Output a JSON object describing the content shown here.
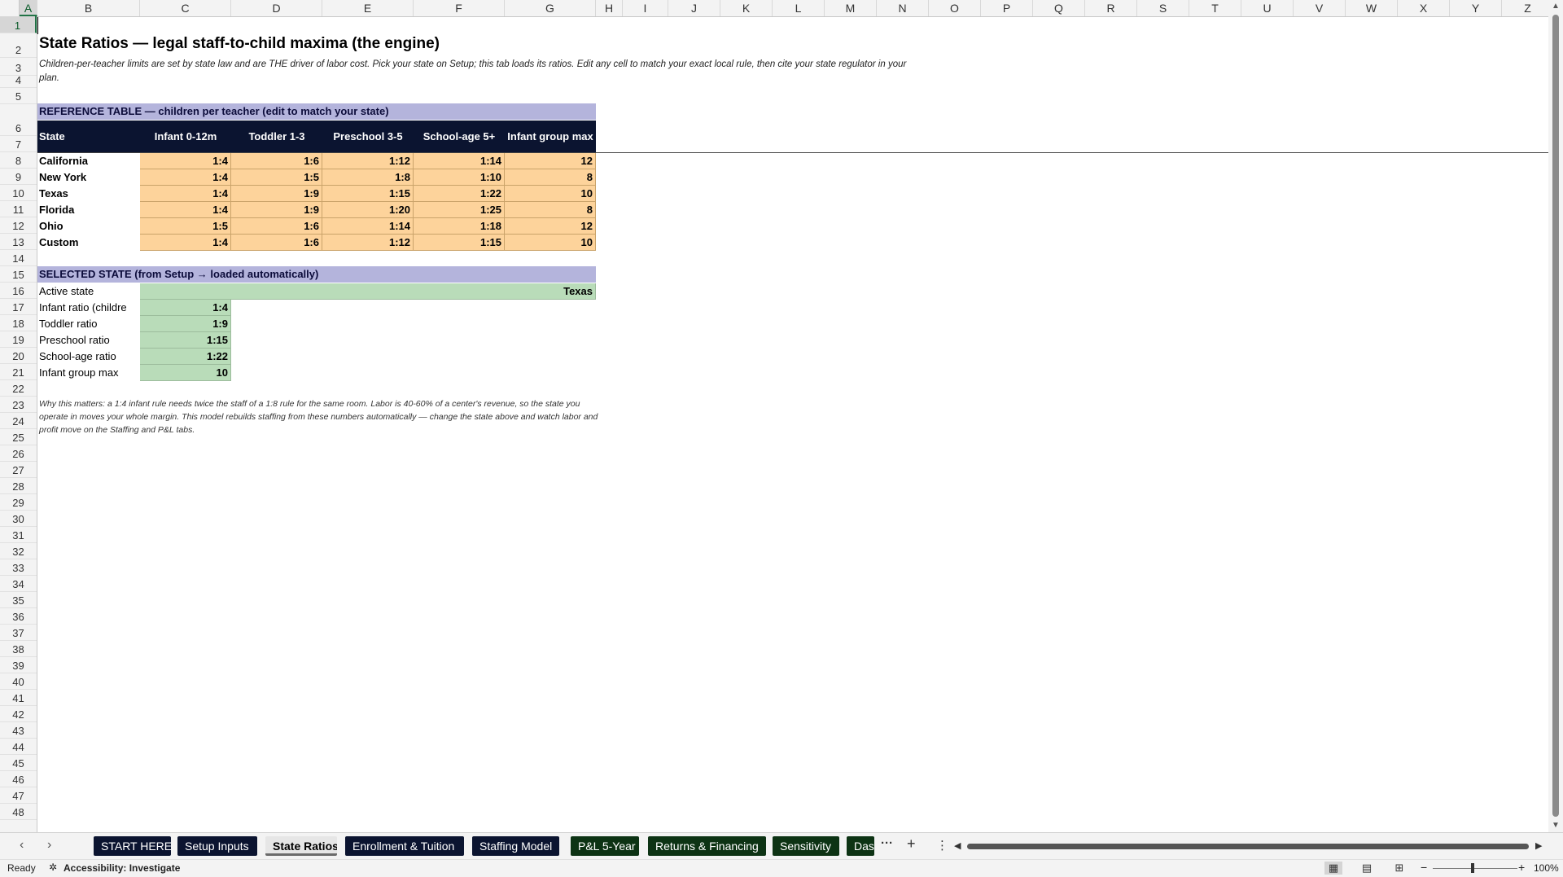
{
  "columns": [
    "A",
    "B",
    "C",
    "D",
    "E",
    "F",
    "G",
    "H",
    "I",
    "J",
    "K",
    "L",
    "M",
    "N",
    "O",
    "P",
    "Q",
    "R",
    "S",
    "T",
    "U",
    "V",
    "W",
    "X",
    "Y",
    "Z"
  ],
  "rows": [
    "1",
    "2",
    "3",
    "4",
    "5",
    "6",
    "7",
    "8",
    "9",
    "10",
    "11",
    "12",
    "13",
    "14",
    "15",
    "16",
    "17",
    "18",
    "19",
    "20",
    "21",
    "22",
    "23",
    "24",
    "25",
    "26",
    "27",
    "28",
    "29",
    "30",
    "31",
    "32",
    "33",
    "34",
    "35",
    "36",
    "37",
    "38",
    "39",
    "40",
    "41",
    "42",
    "43",
    "44",
    "45",
    "46",
    "47",
    "48"
  ],
  "sheet": {
    "title": "State Ratios — legal staff-to-child maxima (the engine)",
    "subtitle": "Children-per-teacher limits are set by state law and are THE driver of labor cost. Pick your state on Setup; this tab loads its ratios. Edit any cell to match your exact local rule, then cite your state regulator in your plan.",
    "reference_band": "REFERENCE TABLE — children per teacher (edit to match your state)",
    "table_headers": [
      "State",
      "Infant 0-12m",
      "Toddler 1-3",
      "Preschool 3-5",
      "School-age 5+",
      "Infant group max"
    ],
    "table_rows": [
      {
        "state": "California",
        "infant": "1:4",
        "toddler": "1:6",
        "preschool": "1:12",
        "school": "1:14",
        "group": "12"
      },
      {
        "state": "New York",
        "infant": "1:4",
        "toddler": "1:5",
        "preschool": "1:8",
        "school": "1:10",
        "group": "8"
      },
      {
        "state": "Texas",
        "infant": "1:4",
        "toddler": "1:9",
        "preschool": "1:15",
        "school": "1:22",
        "group": "10"
      },
      {
        "state": "Florida",
        "infant": "1:4",
        "toddler": "1:9",
        "preschool": "1:20",
        "school": "1:25",
        "group": "8"
      },
      {
        "state": "Ohio",
        "infant": "1:5",
        "toddler": "1:6",
        "preschool": "1:14",
        "school": "1:18",
        "group": "12"
      },
      {
        "state": "Custom",
        "infant": "1:4",
        "toddler": "1:6",
        "preschool": "1:12",
        "school": "1:15",
        "group": "10"
      }
    ],
    "selected_band": "SELECTED STATE  (from Setup → loaded automatically)",
    "active_state_label": "Active state",
    "active_state_value": "Texas",
    "selected_rows": [
      {
        "label": "Infant ratio (childre",
        "value": "1:4"
      },
      {
        "label": "Toddler ratio",
        "value": "1:9"
      },
      {
        "label": "Preschool ratio",
        "value": "1:15"
      },
      {
        "label": "School-age ratio",
        "value": "1:22"
      },
      {
        "label": "Infant group max",
        "value": "10"
      }
    ],
    "note": "Why this matters: a 1:4 infant rule needs twice the staff of a 1:8 rule for the same room. Labor is 40-60% of a center's revenue, so the state you operate in moves your whole margin. This model rebuilds staffing from these numbers automatically — change the state above and watch labor and profit move on the Staffing and P&L tabs."
  },
  "tabs": [
    {
      "label": "START HERE",
      "color": "#0b1430",
      "active": false
    },
    {
      "label": "Setup Inputs",
      "color": "#0b1430",
      "active": false
    },
    {
      "label": "State Ratios",
      "color": "#e6e6e6",
      "active": true
    },
    {
      "label": "Enrollment & Tuition",
      "color": "#0b1430",
      "active": false
    },
    {
      "label": "Staffing Model",
      "color": "#0b1430",
      "active": false
    },
    {
      "label": "P&L 5-Year",
      "color": "#0d3314",
      "active": false
    },
    {
      "label": "Returns & Financing",
      "color": "#0d3314",
      "active": false
    },
    {
      "label": "Sensitivity",
      "color": "#0d3314",
      "active": false
    },
    {
      "label": "Dash",
      "color": "#0d3314",
      "active": false
    }
  ],
  "tab_controls": {
    "more": "···",
    "add": "+",
    "menu": "⋮"
  },
  "status": {
    "ready": "Ready",
    "accessibility": "Accessibility: Investigate",
    "zoom": "100%"
  },
  "colors": {
    "header_navy": "#0b1430",
    "band_lavender": "#b4b4dc",
    "input_orange": "#fdd39b",
    "calc_green": "#b9dcb9"
  }
}
